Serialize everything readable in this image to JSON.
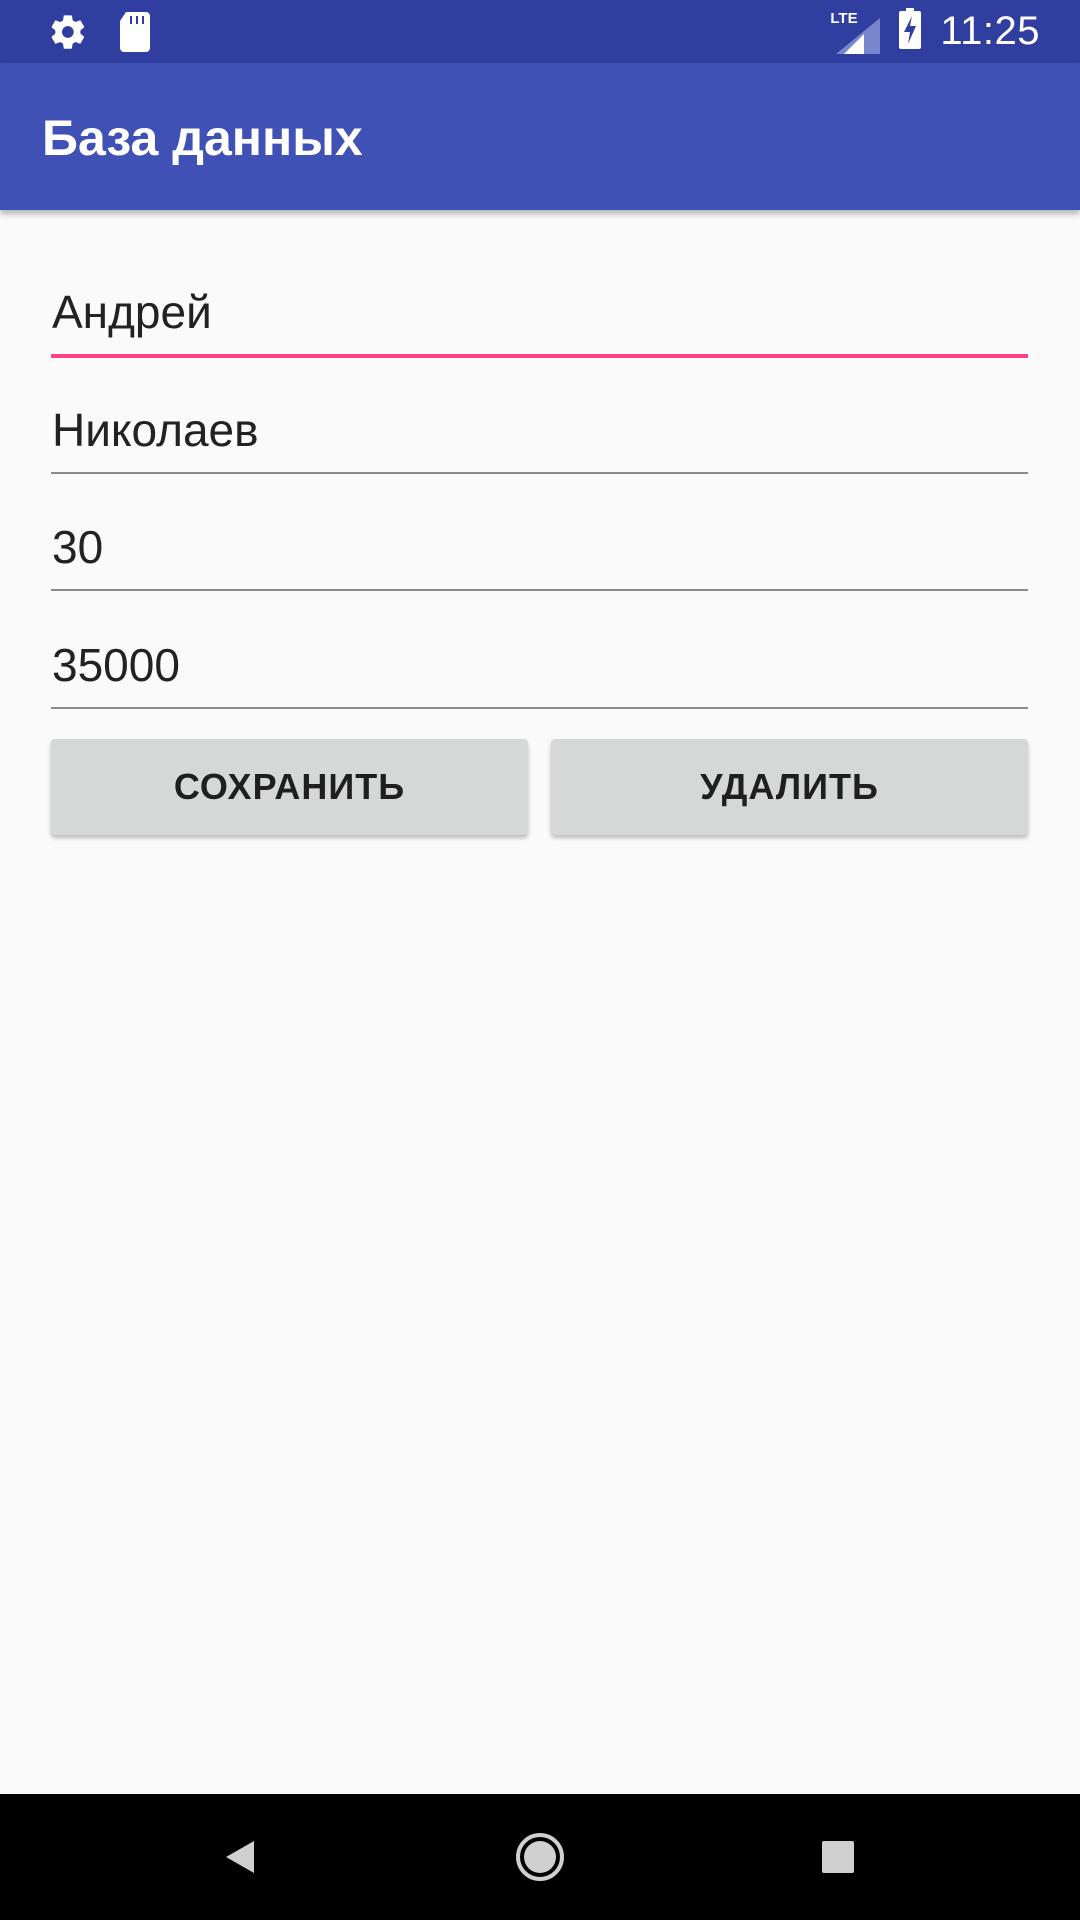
{
  "status_bar": {
    "time": "11:25",
    "network_label": "LTE",
    "icons": [
      "settings-icon",
      "sd-card-icon",
      "signal-icon",
      "battery-charging-icon"
    ]
  },
  "app_bar": {
    "title": "База данных"
  },
  "form": {
    "first_name": "Андрей",
    "last_name": "Николаев",
    "age": "30",
    "salary": "35000"
  },
  "buttons": {
    "save": "СОХРАНИТЬ",
    "delete": "УДАЛИТЬ"
  },
  "nav_bar": {
    "icons": [
      "back-icon",
      "home-icon",
      "recents-icon"
    ]
  },
  "colors": {
    "status_bar": "#303f9f",
    "app_bar": "#3f51b5",
    "accent": "#ff4081",
    "background": "#fafafa",
    "button": "#d6d7d7"
  }
}
